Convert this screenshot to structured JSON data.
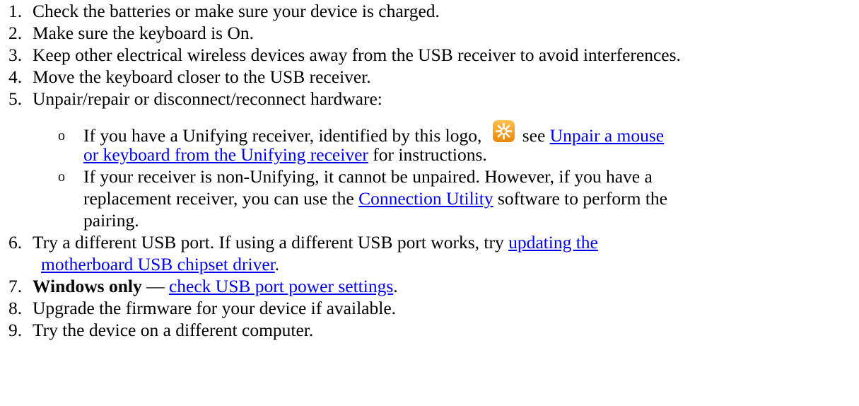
{
  "items": [
    {
      "num": "1.",
      "text": "Check the batteries or make sure your device is charged."
    },
    {
      "num": "2.",
      "text": "Make sure the keyboard is On."
    },
    {
      "num": "3.",
      "text": "Keep other electrical wireless devices away from the USB receiver to avoid interferences."
    },
    {
      "num": "4.",
      "text": "Move the keyboard closer to the USB receiver."
    },
    {
      "num": "5.",
      "text": "Unpair/repair or disconnect/reconnect hardware:"
    }
  ],
  "sub": {
    "bullet": "o",
    "a_pre": "If you have a Unifying receiver, identified by this logo,",
    "a_see": "see",
    "a_link_1": "Unpair a mouse",
    "a_link_2": "or keyboard from the Unifying receiver",
    "a_post": "for instructions.",
    "b_line1": "If your receiver is non-Unifying, it cannot be unpaired. However, if you have a",
    "b_line2_pre": "replacement receiver, you can use the",
    "b_link": "Connection Utility",
    "b_line2_post": "software to perform the",
    "b_line3": "pairing."
  },
  "item6": {
    "num": "6.",
    "pre": "Try a different USB port. If using a different USB port works, try",
    "link_1": "updating the",
    "link_2": "motherboard USB chipset driver",
    "post": "."
  },
  "item7": {
    "num": "7.",
    "bold": "Windows only",
    "dash": "—",
    "link": "check USB port power settings",
    "post": "."
  },
  "item8": {
    "num": "8.",
    "text": "Upgrade the firmware for your device if available."
  },
  "item9": {
    "num": "9.",
    "text": "Try the device on a different computer."
  },
  "colors": {
    "link": "#0000ee",
    "logo_orange": "#f39c12",
    "text": "#000000"
  },
  "icons": {
    "unifying_logo": "unifying-logo-icon"
  }
}
